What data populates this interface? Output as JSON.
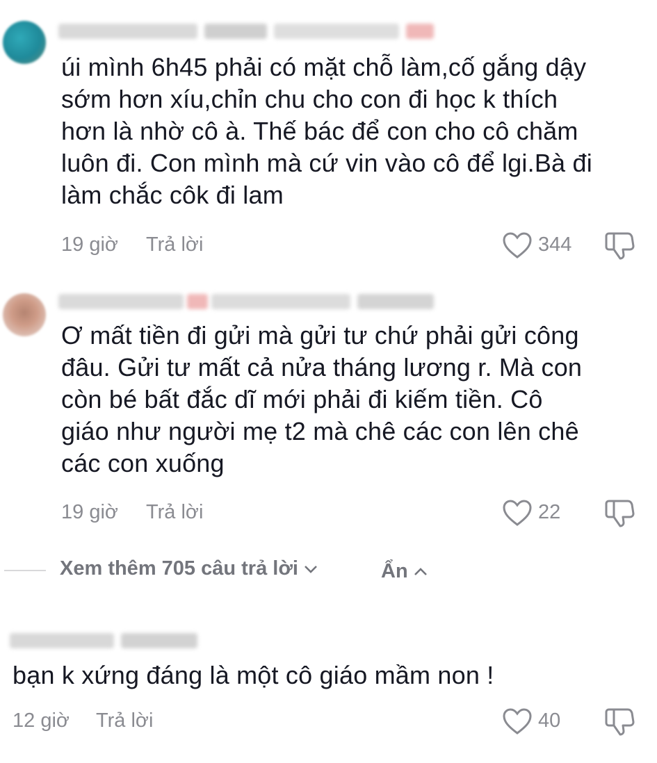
{
  "comments": [
    {
      "text_lines": [
        "úi mình 6h45 phải có mặt chỗ làm,cố gắng dậy",
        "sớm hơn xíu,chỉn chu cho con đi học k thích",
        "hơn là nhờ cô à. Thế bác để con cho cô chăm",
        "luôn đi. Con mình mà cứ vin vào cô để lgi.Bà đi",
        "làm chắc côk đi lam"
      ],
      "time": "19 giờ",
      "reply_label": "Trả lời",
      "likes": "344"
    },
    {
      "text_lines": [
        "Ơ mất tiền đi gửi mà gửi tư chứ phải gửi công",
        "đâu. Gửi tư mất cả nửa tháng lương r. Mà con",
        "còn bé bất đắc dĩ mới phải đi kiếm tiền. Cô",
        "giáo như người mẹ t2 mà chê các con lên chê",
        "các con xuống"
      ],
      "time": "19 giờ",
      "reply_label": "Trả lời",
      "likes": "22"
    },
    {
      "text_lines": [
        "bạn k xứng đáng là một cô giáo mầm non !"
      ],
      "time": "12 giờ",
      "reply_label": "Trả lời",
      "likes": "40"
    }
  ],
  "thread": {
    "view_more_label": "Xem thêm 705 câu trả lời",
    "hide_label": "Ẩn"
  },
  "icons": {
    "like": "heart-outline-icon",
    "dislike": "thumbs-down-outline-icon",
    "expand": "chevron-down-icon",
    "collapse": "chevron-up-icon"
  },
  "colors": {
    "text": "#161823",
    "muted": "#8a8b91"
  }
}
